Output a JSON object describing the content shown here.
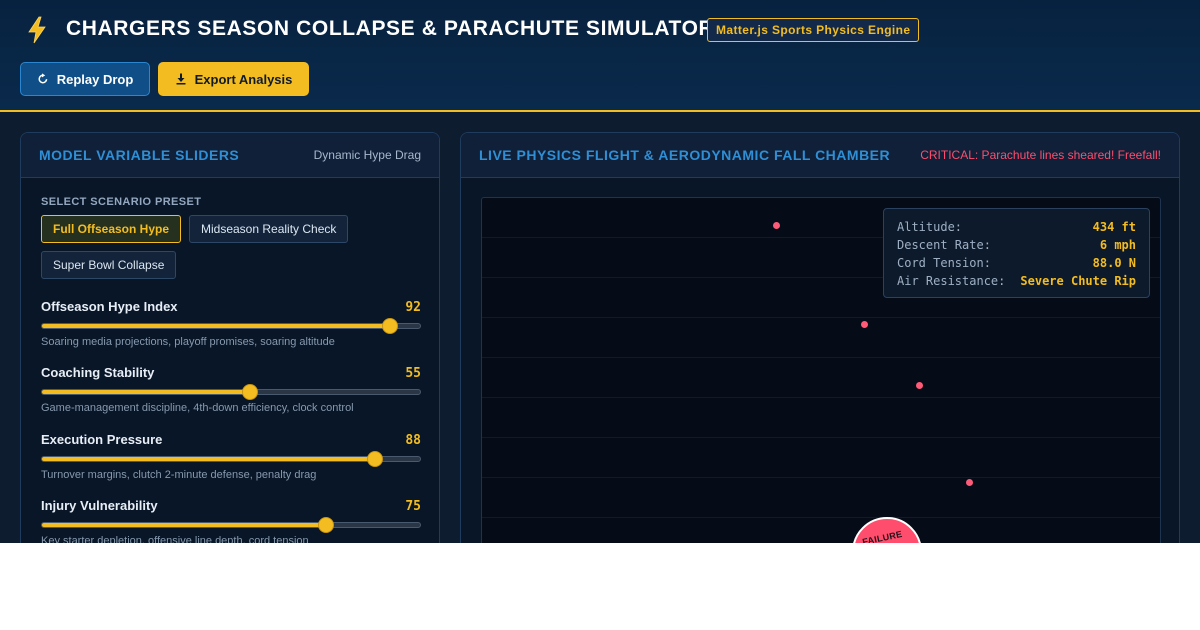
{
  "header": {
    "title": "CHARGERS SEASON COLLAPSE & PARACHUTE SIMULATOR",
    "engine_badge": "Matter.js Sports Physics Engine",
    "replay_label": "Replay Drop",
    "export_label": "Export Analysis"
  },
  "left_panel": {
    "title": "MODEL VARIABLE SLIDERS",
    "subtitle": "Dynamic Hype Drag",
    "preset_label": "SELECT SCENARIO PRESET",
    "presets": [
      {
        "label": "Full Offseason Hype",
        "active": true
      },
      {
        "label": "Midseason Reality Check",
        "active": false
      },
      {
        "label": "Super Bowl Collapse",
        "active": false
      }
    ],
    "sliders": [
      {
        "name": "Offseason Hype Index",
        "value": 92,
        "min": 0,
        "max": 100,
        "description": "Soaring media projections, playoff promises, soaring altitude"
      },
      {
        "name": "Coaching Stability",
        "value": 55,
        "min": 0,
        "max": 100,
        "description": "Game-management discipline, 4th-down efficiency, clock control"
      },
      {
        "name": "Execution Pressure",
        "value": 88,
        "min": 0,
        "max": 100,
        "description": "Turnover margins, clutch 2-minute defense, penalty drag"
      },
      {
        "name": "Injury Vulnerability",
        "value": 75,
        "min": 0,
        "max": 100,
        "description": "Key starter depletion, offensive line depth, cord tension"
      }
    ]
  },
  "right_panel": {
    "title": "LIVE PHYSICS FLIGHT & AERODYNAMIC FALL CHAMBER",
    "alert": "CRITICAL: Parachute lines sheared! Freefall!",
    "telemetry": [
      {
        "key": "Altitude:",
        "value": "434 ft"
      },
      {
        "key": "Descent Rate:",
        "value": "6 mph"
      },
      {
        "key": "Cord Tension:",
        "value": "88.0 N"
      },
      {
        "key": "Air Resistance:",
        "value": "Severe Chute Rip"
      }
    ],
    "failure_badge": "FAILURE"
  },
  "colors": {
    "accent": "#f3bd21",
    "primary": "#2f8fd6",
    "alert": "#ff4d6d",
    "background": "#0d1c2e"
  },
  "icons": {
    "logo": "lightning-bolt-icon",
    "replay": "replay-icon",
    "export": "download-icon"
  }
}
